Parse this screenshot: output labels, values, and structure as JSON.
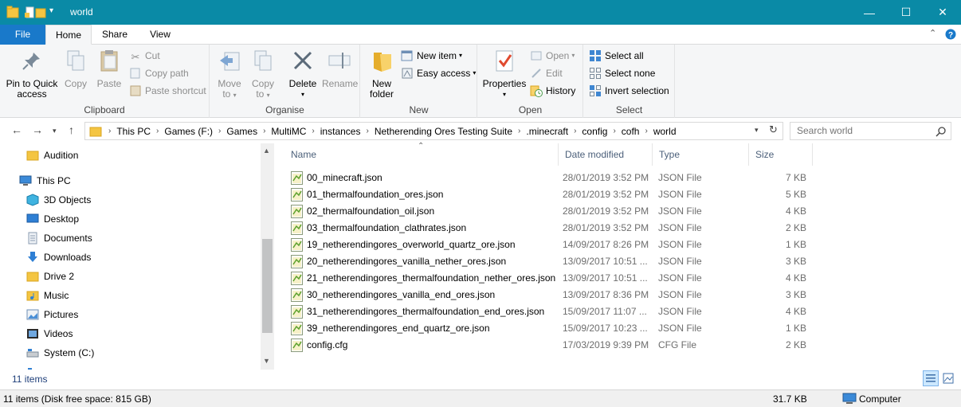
{
  "window": {
    "title": "world",
    "minimize_glyph": "—",
    "maximize_glyph": "☐",
    "close_glyph": "✕"
  },
  "ribbon_tabs": [
    "File",
    "Home",
    "Share",
    "View"
  ],
  "ribbon": {
    "clipboard": {
      "label": "Clipboard",
      "pin": "Pin to Quick access",
      "pin_l1": "Pin to Quick",
      "pin_l2": "access",
      "copy": "Copy",
      "paste": "Paste",
      "cut": "Cut",
      "copy_path": "Copy path",
      "paste_shortcut": "Paste shortcut"
    },
    "organise": {
      "label": "Organise",
      "move_to": "Move",
      "move_to_2": "to",
      "copy_to": "Copy",
      "copy_to_2": "to",
      "delete": "Delete",
      "rename": "Rename"
    },
    "new": {
      "label": "New",
      "new_folder_1": "New",
      "new_folder_2": "folder",
      "new_item": "New item",
      "easy_access": "Easy access"
    },
    "open": {
      "label": "Open",
      "properties": "Properties",
      "open": "Open",
      "edit": "Edit",
      "history": "History"
    },
    "select": {
      "label": "Select",
      "select_all": "Select all",
      "select_none": "Select none",
      "invert": "Invert selection"
    }
  },
  "address": {
    "crumbs": [
      "This PC",
      "Games (F:)",
      "Games",
      "MultiMC",
      "instances",
      "Netherending Ores Testing Suite",
      ".minecraft",
      "config",
      "cofh",
      "world"
    ],
    "search_placeholder": "Search world"
  },
  "nav_pane": [
    {
      "label": "Audition",
      "icon": "folder-icon"
    },
    {
      "label": "This PC",
      "icon": "computer-icon"
    },
    {
      "label": "3D Objects",
      "icon": "cube-icon"
    },
    {
      "label": "Desktop",
      "icon": "desktop-icon"
    },
    {
      "label": "Documents",
      "icon": "documents-icon"
    },
    {
      "label": "Downloads",
      "icon": "download-icon"
    },
    {
      "label": "Drive 2",
      "icon": "folder-icon"
    },
    {
      "label": "Music",
      "icon": "music-icon"
    },
    {
      "label": "Pictures",
      "icon": "pictures-icon"
    },
    {
      "label": "Videos",
      "icon": "videos-icon"
    },
    {
      "label": "System (C:)",
      "icon": "drive-icon"
    }
  ],
  "columns": {
    "name": "Name",
    "date": "Date modified",
    "type": "Type",
    "size": "Size"
  },
  "files": [
    {
      "name": "00_minecraft.json",
      "date": "28/01/2019 3:52 PM",
      "type": "JSON File",
      "size": "7 KB"
    },
    {
      "name": "01_thermalfoundation_ores.json",
      "date": "28/01/2019 3:52 PM",
      "type": "JSON File",
      "size": "5 KB"
    },
    {
      "name": "02_thermalfoundation_oil.json",
      "date": "28/01/2019 3:52 PM",
      "type": "JSON File",
      "size": "4 KB"
    },
    {
      "name": "03_thermalfoundation_clathrates.json",
      "date": "28/01/2019 3:52 PM",
      "type": "JSON File",
      "size": "2 KB"
    },
    {
      "name": "19_netherendingores_overworld_quartz_ore.json",
      "date": "14/09/2017 8:26 PM",
      "type": "JSON File",
      "size": "1 KB"
    },
    {
      "name": "20_netherendingores_vanilla_nether_ores.json",
      "date": "13/09/2017 10:51 ...",
      "type": "JSON File",
      "size": "3 KB"
    },
    {
      "name": "21_netherendingores_thermalfoundation_nether_ores.json",
      "date": "13/09/2017 10:51 ...",
      "type": "JSON File",
      "size": "4 KB"
    },
    {
      "name": "30_netherendingores_vanilla_end_ores.json",
      "date": "13/09/2017 8:36 PM",
      "type": "JSON File",
      "size": "3 KB"
    },
    {
      "name": "31_netherendingores_thermalfoundation_end_ores.json",
      "date": "15/09/2017 11:07 ...",
      "type": "JSON File",
      "size": "4 KB"
    },
    {
      "name": "39_netherendingores_end_quartz_ore.json",
      "date": "15/09/2017 10:23 ...",
      "type": "JSON File",
      "size": "1 KB"
    },
    {
      "name": "config.cfg",
      "date": "17/03/2019 9:39 PM",
      "type": "CFG File",
      "size": "2 KB"
    }
  ],
  "status": {
    "item_count": "11 items",
    "disk": "11 items (Disk free space: 815 GB)",
    "size": "31.7 KB",
    "location": "Computer"
  },
  "colors": {
    "titlebar": "#0a8aa6",
    "file_tab": "#1979ca",
    "ribbon_bg": "#f5f6f7",
    "folder": "#f4c542"
  }
}
